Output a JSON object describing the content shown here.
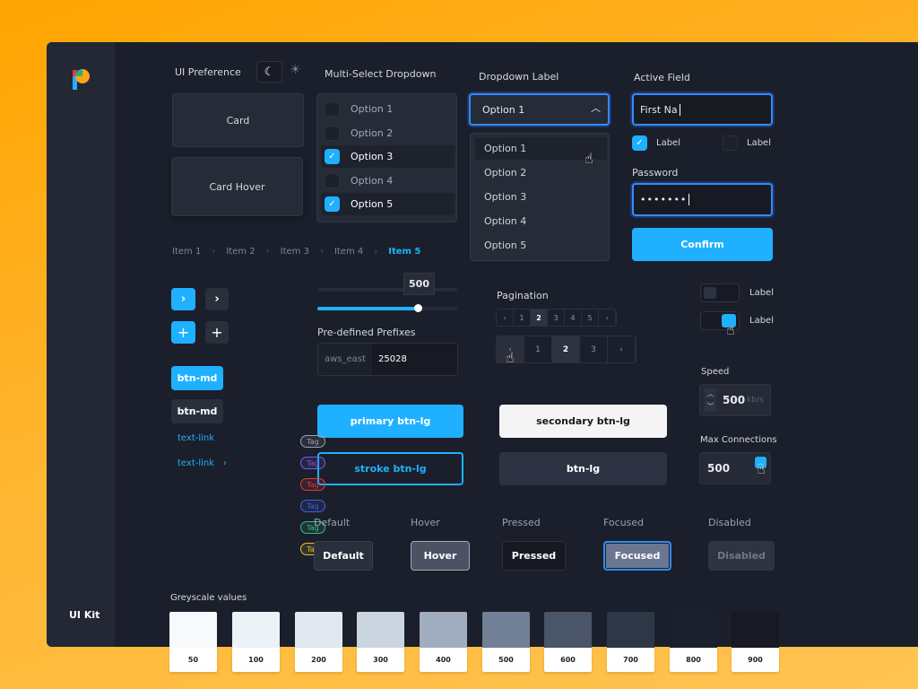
{
  "app": {
    "sidebar_label": "UI Kit"
  },
  "ui_preference": {
    "label": "UI Preference",
    "dark_icon": "moon-icon",
    "light_icon": "sun-icon"
  },
  "cards": {
    "card": "Card",
    "card_hover": "Card Hover"
  },
  "multi_select": {
    "label": "Multi-Select Dropdown",
    "options": [
      {
        "label": "Option 1",
        "checked": false
      },
      {
        "label": "Option 2",
        "checked": false
      },
      {
        "label": "Option 3",
        "checked": true
      },
      {
        "label": "Option 4",
        "checked": false
      },
      {
        "label": "Option 5",
        "checked": true
      }
    ]
  },
  "dropdown": {
    "label": "Dropdown Label",
    "selected": "Option 1",
    "options": [
      "Option 1",
      "Option 2",
      "Option 3",
      "Option 4",
      "Option 5"
    ]
  },
  "active_field": {
    "label": "Active Field",
    "value": "First Na",
    "check1_label": "Label",
    "check1_checked": true,
    "check2_label": "Label",
    "check2_checked": false
  },
  "password": {
    "label": "Password",
    "value": "•••••••"
  },
  "confirm": "Confirm",
  "breadcrumb": [
    "Item 1",
    "Item 2",
    "Item 3",
    "Item 4",
    "Item 5"
  ],
  "slider": {
    "value": "500",
    "fill_percent": 72
  },
  "prefix": {
    "label": "Pre-defined Prefixes",
    "prefix": "aws_east",
    "value": "25028"
  },
  "pagination": {
    "label": "Pagination",
    "small": [
      "‹",
      "1",
      "2",
      "3",
      "4",
      "5",
      "›"
    ],
    "large": [
      "‹",
      "1",
      "2",
      "3",
      "›"
    ],
    "current": "2"
  },
  "toggles": [
    {
      "label": "Label",
      "on": false
    },
    {
      "label": "Label",
      "on": true
    }
  ],
  "speed": {
    "label": "Speed",
    "value": "500",
    "unit": "kb/s"
  },
  "max_connections": {
    "label": "Max Connections",
    "value": "500"
  },
  "buttons": {
    "btn_md_primary": "btn-md",
    "btn_md": "btn-md",
    "text_link1": "text-link",
    "text_link2": "text-link",
    "primary_lg": "primary btn-lg",
    "stroke_lg": "stroke btn-lg",
    "secondary_lg": "secondary btn-lg",
    "btn_lg": "btn-lg"
  },
  "tags": [
    {
      "label": "Tag",
      "color": "#9aa1ae"
    },
    {
      "label": "Tag",
      "color": "#7b5cf0"
    },
    {
      "label": "Tag",
      "color": "#e03c3c"
    },
    {
      "label": "Tag",
      "color": "#3d63e0"
    },
    {
      "label": "Tag",
      "color": "#2fc08a"
    },
    {
      "label": "Tag",
      "color": "#e0c22a"
    }
  ],
  "states": [
    {
      "heading": "Default",
      "label": "Default"
    },
    {
      "heading": "Hover",
      "label": "Hover"
    },
    {
      "heading": "Pressed",
      "label": "Pressed"
    },
    {
      "heading": "Focused",
      "label": "Focused"
    },
    {
      "heading": "Disabled",
      "label": "Disabled"
    }
  ],
  "greyscale": {
    "label": "Greyscale values",
    "swatches": [
      {
        "name": "50",
        "color": "#f7fafc"
      },
      {
        "name": "100",
        "color": "#edf2f7"
      },
      {
        "name": "200",
        "color": "#e2e8f0"
      },
      {
        "name": "300",
        "color": "#cbd5e0"
      },
      {
        "name": "400",
        "color": "#a0aec0"
      },
      {
        "name": "500",
        "color": "#718096"
      },
      {
        "name": "600",
        "color": "#4a5568"
      },
      {
        "name": "700",
        "color": "#2d3748"
      },
      {
        "name": "800",
        "color": "#1a202c"
      },
      {
        "name": "900",
        "color": "#171923"
      }
    ]
  },
  "colors": {
    "accent": "#1fb0ff",
    "focus": "#2f8cff"
  }
}
